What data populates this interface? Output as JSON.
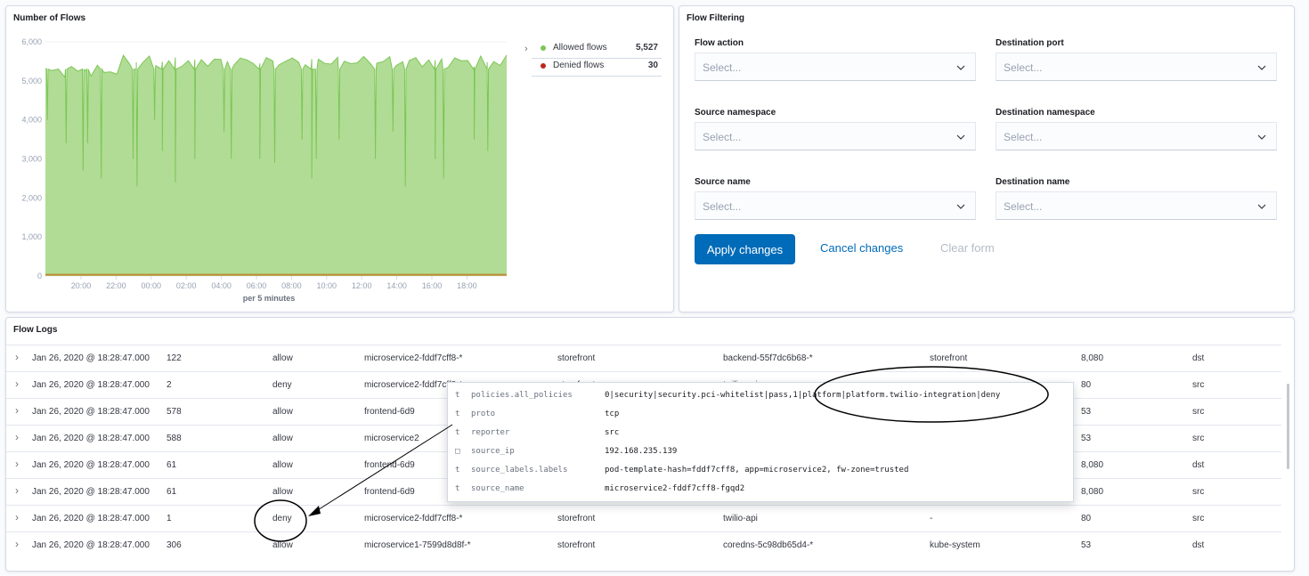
{
  "flows_panel": {
    "title": "Number of Flows",
    "legend": [
      {
        "label": "Allowed flows",
        "value": "5,527",
        "color": "#7cc656"
      },
      {
        "label": "Denied flows",
        "value": "30",
        "color": "#bd271e"
      }
    ],
    "legend_chevron": "›"
  },
  "chart_data": {
    "type": "area",
    "title": "Number of Flows",
    "xlabel": "per 5 minutes",
    "ylabel": "",
    "ylim": [
      0,
      6000
    ],
    "yticks": [
      "6,000",
      "5,000",
      "4,000",
      "3,000",
      "2,000",
      "1,000",
      "0"
    ],
    "xticks": [
      "20:00",
      "22:00",
      "00:00",
      "02:00",
      "04:00",
      "06:00",
      "08:00",
      "10:00",
      "12:00",
      "14:00",
      "16:00",
      "18:00"
    ],
    "grid": true,
    "series": [
      {
        "name": "Allowed flows",
        "color": "#7cc656",
        "baseline": 5500,
        "noise": 150,
        "dips": [
          [
            0.3,
            4000
          ],
          [
            3.2,
            3400
          ],
          [
            5.8,
            2700
          ],
          [
            6.5,
            3400
          ],
          [
            8.6,
            2500
          ],
          [
            13.5,
            3000
          ],
          [
            14.1,
            2300
          ],
          [
            16.8,
            4000
          ],
          [
            18.0,
            3200
          ],
          [
            20.0,
            2400
          ],
          [
            23.0,
            3000
          ],
          [
            27.5,
            3700
          ],
          [
            28.6,
            3000
          ],
          [
            33.0,
            3000
          ],
          [
            35.3,
            2900
          ],
          [
            39.5,
            3500
          ],
          [
            41.0,
            2500
          ],
          [
            41.7,
            3000
          ],
          [
            45.2,
            3500
          ],
          [
            50.8,
            3000
          ],
          [
            53.5,
            3700
          ],
          [
            55.4,
            2300
          ],
          [
            60.0,
            3000
          ],
          [
            61.3,
            2500
          ],
          [
            66.0,
            3500
          ],
          [
            68.1,
            3200
          ]
        ]
      },
      {
        "name": "Denied flows",
        "color": "#bd271e",
        "baseline": 30
      }
    ]
  },
  "filter_panel": {
    "title": "Flow Filtering",
    "fields": [
      {
        "label": "Flow action",
        "placeholder": "Select..."
      },
      {
        "label": "Destination port",
        "placeholder": "Select..."
      },
      {
        "label": "Source namespace",
        "placeholder": "Select..."
      },
      {
        "label": "Destination namespace",
        "placeholder": "Select..."
      },
      {
        "label": "Source name",
        "placeholder": "Select..."
      },
      {
        "label": "Destination name",
        "placeholder": "Select..."
      }
    ],
    "apply_label": "Apply changes",
    "cancel_label": "Cancel changes",
    "clear_label": "Clear form"
  },
  "logs_panel": {
    "title": "Flow Logs",
    "rows": [
      {
        "time": "Jan 26, 2020 @ 18:28:47.000",
        "count": "122",
        "action": "allow",
        "source": "microservice2-fddf7cff8-*",
        "src_ns": "storefront",
        "dest": "backend-55f7dc6b68-*",
        "dest_ns": "storefront",
        "port": "8,080",
        "reporter": "dst"
      },
      {
        "time": "Jan 26, 2020 @ 18:28:47.000",
        "count": "2",
        "action": "deny",
        "source": "microservice2-fddf7cff8-*",
        "src_ns": "storefront",
        "dest": "twilio-api",
        "dest_ns": "-",
        "port": "80",
        "reporter": "src"
      },
      {
        "time": "Jan 26, 2020 @ 18:28:47.000",
        "count": "578",
        "action": "allow",
        "source": "frontend-6d9",
        "src_ns": "",
        "dest": "",
        "dest_ns": "",
        "port": "53",
        "reporter": "src"
      },
      {
        "time": "Jan 26, 2020 @ 18:28:47.000",
        "count": "588",
        "action": "allow",
        "source": "microservice2",
        "src_ns": "",
        "dest": "",
        "dest_ns": "",
        "port": "53",
        "reporter": "src"
      },
      {
        "time": "Jan 26, 2020 @ 18:28:47.000",
        "count": "61",
        "action": "allow",
        "source": "frontend-6d9",
        "src_ns": "",
        "dest": "",
        "dest_ns": "",
        "port": "8,080",
        "reporter": "dst"
      },
      {
        "time": "Jan 26, 2020 @ 18:28:47.000",
        "count": "61",
        "action": "allow",
        "source": "frontend-6d9",
        "src_ns": "",
        "dest": "",
        "dest_ns": "",
        "port": "8,080",
        "reporter": "src"
      },
      {
        "time": "Jan 26, 2020 @ 18:28:47.000",
        "count": "1",
        "action": "deny",
        "source": "microservice2-fddf7cff8-*",
        "src_ns": "storefront",
        "dest": "twilio-api",
        "dest_ns": "-",
        "port": "80",
        "reporter": "src"
      },
      {
        "time": "Jan 26, 2020 @ 18:28:47.000",
        "count": "306",
        "action": "allow",
        "source": "microservice1-7599d8d8f-*",
        "src_ns": "storefront",
        "dest": "coredns-5c98db65d4-*",
        "dest_ns": "kube-system",
        "port": "53",
        "reporter": "dst"
      }
    ],
    "row_chevron": "›"
  },
  "popover": {
    "rows": [
      {
        "type": "t",
        "field": "policies.all_policies",
        "value": "0|security|security.pci-whitelist|pass,1|platform|platform.twilio-integration|deny"
      },
      {
        "type": "t",
        "field": "proto",
        "value": "tcp"
      },
      {
        "type": "t",
        "field": "reporter",
        "value": "src"
      },
      {
        "type": "□",
        "field": "source_ip",
        "value": "192.168.235.139"
      },
      {
        "type": "t",
        "field": "source_labels.labels",
        "value": "pod-template-hash=fddf7cff8, app=microservice2, fw-zone=trusted"
      },
      {
        "type": "t",
        "field": "source_name",
        "value": "microservice2-fddf7cff8-fgqd2"
      }
    ]
  }
}
